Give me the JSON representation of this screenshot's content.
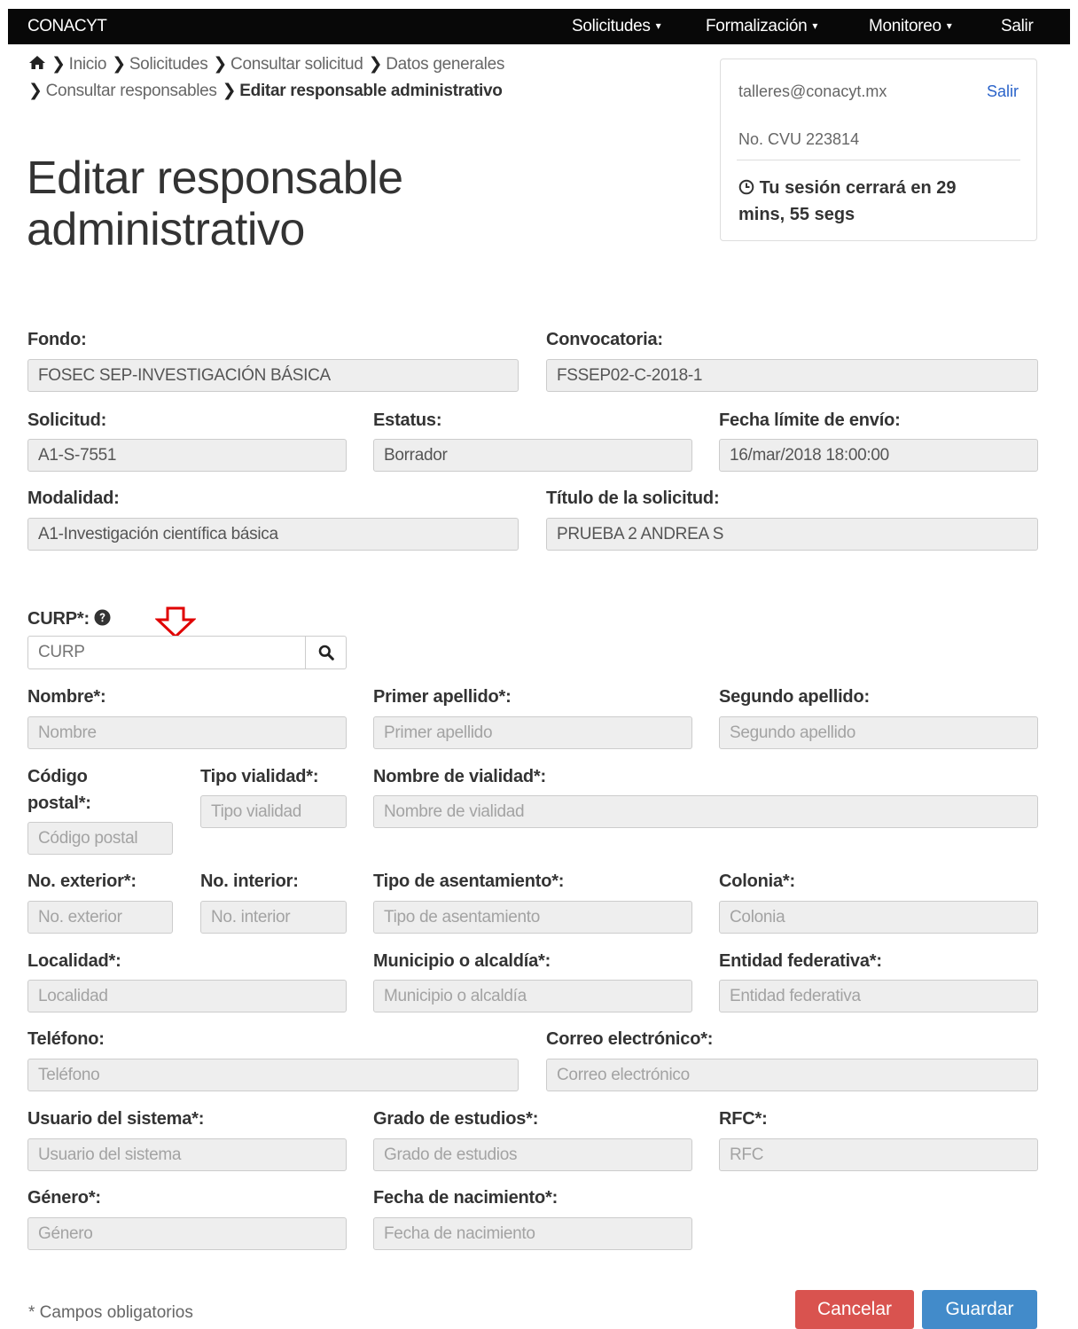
{
  "navbar": {
    "brand": "CONACYT",
    "items": [
      {
        "label": "Solicitudes",
        "caret": "▾"
      },
      {
        "label": "Formalización",
        "caret": "▾"
      },
      {
        "label": "Monitoreo",
        "caret": "▾"
      },
      {
        "label": "Salir"
      }
    ]
  },
  "breadcrumb": {
    "items": [
      "Inicio",
      "Solicitudes",
      "Consultar solicitud",
      "Datos generales",
      "Consultar responsables"
    ],
    "current": "Editar responsable administrativo"
  },
  "page_title_line1": "Editar responsable",
  "page_title_line2": "administrativo",
  "user_box": {
    "email": "talleres@conacyt.mx",
    "logout": "Salir",
    "cvu": "No. CVU 223814",
    "session_line1": "Tu sesión cerrará en 29",
    "session_line2": "mins, 55 segs"
  },
  "general": {
    "fondo": {
      "label": "Fondo:",
      "value": "FOSEC SEP-INVESTIGACIÓN BÁSICA"
    },
    "convocatoria": {
      "label": "Convocatoria:",
      "value": "FSSEP02-C-2018-1"
    },
    "solicitud": {
      "label": "Solicitud:",
      "value": "A1-S-7551"
    },
    "estatus": {
      "label": "Estatus:",
      "value": "Borrador"
    },
    "fecha_limite": {
      "label": "Fecha límite de envío:",
      "value": "16/mar/2018 18:00:00"
    },
    "modalidad": {
      "label": "Modalidad:",
      "value": "A1-Investigación científica básica"
    },
    "titulo": {
      "label": "Título de la solicitud:",
      "value": "PRUEBA 2 ANDREA S"
    }
  },
  "form": {
    "curp": {
      "label": "CURP*:",
      "placeholder": "CURP"
    },
    "nombre": {
      "label": "Nombre*:",
      "placeholder": "Nombre"
    },
    "primer_apellido": {
      "label": "Primer apellido*:",
      "placeholder": "Primer apellido"
    },
    "segundo_apellido": {
      "label": "Segundo apellido:",
      "placeholder": "Segundo apellido"
    },
    "codigo_postal": {
      "label_line1": "Código",
      "label_line2": "postal*:",
      "placeholder": "Código postal"
    },
    "tipo_vialidad": {
      "label": "Tipo vialidad*:",
      "placeholder": "Tipo vialidad"
    },
    "nombre_vialidad": {
      "label": "Nombre de vialidad*:",
      "placeholder": "Nombre de vialidad"
    },
    "no_exterior": {
      "label": "No. exterior*:",
      "placeholder": "No. exterior"
    },
    "no_interior": {
      "label": "No. interior:",
      "placeholder": "No. interior"
    },
    "tipo_asentamiento": {
      "label": "Tipo de asentamiento*:",
      "placeholder": "Tipo de asentamiento"
    },
    "colonia": {
      "label": "Colonia*:",
      "placeholder": "Colonia"
    },
    "localidad": {
      "label": "Localidad*:",
      "placeholder": "Localidad"
    },
    "municipio": {
      "label": "Municipio o alcaldía*:",
      "placeholder": "Municipio o alcaldía"
    },
    "entidad": {
      "label": "Entidad federativa*:",
      "placeholder": "Entidad federativa"
    },
    "telefono": {
      "label": "Teléfono:",
      "placeholder": "Teléfono"
    },
    "correo": {
      "label": "Correo electrónico*:",
      "placeholder": "Correo electrónico"
    },
    "usuario": {
      "label": "Usuario del sistema*:",
      "placeholder": "Usuario del sistema"
    },
    "grado": {
      "label": "Grado de estudios*:",
      "placeholder": "Grado de estudios"
    },
    "rfc": {
      "label": "RFC*:",
      "placeholder": "RFC"
    },
    "genero": {
      "label": "Género*:",
      "placeholder": "Género"
    },
    "fecha_nacimiento": {
      "label": "Fecha de nacimiento*:",
      "placeholder": "Fecha de nacimiento"
    }
  },
  "footer": {
    "required_note": "* Campos obligatorios",
    "cancel": "Cancelar",
    "save": "Guardar"
  },
  "colors": {
    "navbar_bg": "#080808",
    "cancel_bg": "#d9534f",
    "save_bg": "#428bca",
    "link": "#2a63c9",
    "annotation_arrow": "#e00000"
  },
  "icons": {
    "home": "home-icon",
    "breadcrumb_separator": "chevron-right-icon",
    "clock": "clock-icon",
    "help": "question-circle-icon",
    "search": "search-icon",
    "annotation": "down-arrow-icon"
  }
}
